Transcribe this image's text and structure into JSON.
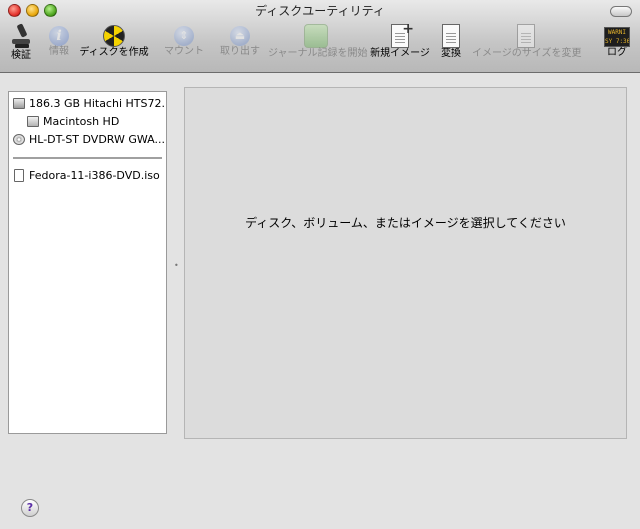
{
  "window": {
    "title": "ディスクユーティリティ"
  },
  "toolbar": {
    "verify": "検証",
    "info": "情報",
    "burn": "ディスクを作成",
    "mount": "マウント",
    "eject": "取り出す",
    "journal": "ジャーナル記録を開始",
    "new_image": "新規イメージ",
    "convert": "変換",
    "resize": "イメージのサイズを変更",
    "log": "ログ",
    "log_icon_text": "WARNI\nSY 7:36"
  },
  "sidebar": {
    "items": [
      {
        "label": "186.3 GB Hitachi HTS72...",
        "icon": "hard-disk-icon"
      },
      {
        "label": "Macintosh HD",
        "icon": "volume-icon"
      },
      {
        "label": "HL-DT-ST DVDRW GWA...",
        "icon": "dvd-drive-icon"
      },
      {
        "label": "Fedora-11-i386-DVD.iso",
        "icon": "disk-image-icon"
      }
    ]
  },
  "main": {
    "prompt": "ディスク、ボリューム、またはイメージを選択してください"
  },
  "help": {
    "label": "?"
  },
  "colors": {
    "window_bg": "#e3e3e3",
    "pane_bg": "#dcdcdc",
    "disabled_text": "#8a8a8a"
  }
}
